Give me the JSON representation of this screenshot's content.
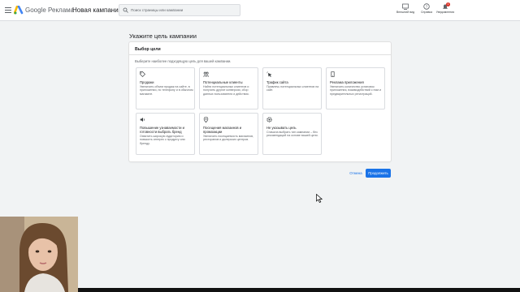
{
  "header": {
    "brand": "Google Реклама",
    "page_title": "Новая кампания",
    "search_placeholder": "Поиск страницы или кампании",
    "tools": [
      {
        "label": "Внешний вид",
        "icon": "appearance-icon"
      },
      {
        "label": "Справка",
        "icon": "help-icon"
      },
      {
        "label": "Уведомления",
        "icon": "notifications-icon",
        "badge": "1"
      }
    ]
  },
  "main": {
    "heading": "Укажите цель кампании",
    "panel": {
      "title": "Выбор цели",
      "subtitle": "Выберите наиболее подходящую цель для вашей кампании.",
      "cards": [
        {
          "icon": "tag-icon",
          "title": "Продажи",
          "description": "Увеличить объем продаж на сайте, в приложении, по телефону и в обычном магазине."
        },
        {
          "icon": "people-icon",
          "title": "Потенциальные клиенты",
          "description": "Найти потенциальных клиентов и получить другие конверсии, сбор данных пользователя и действия."
        },
        {
          "icon": "cursor-click-icon",
          "title": "Трафик сайта",
          "description": "Привлечь потенциальных клиентов на сайт."
        },
        {
          "icon": "phone-icon",
          "title": "Реклама приложения",
          "description": "Увеличить количество установок приложения, взаимодействий с ним и предварительных регистраций."
        },
        {
          "icon": "speaker-icon",
          "title": "Повышение узнаваемости и готовности выбрать бренд",
          "description": "Охватить широкую аудиторию и повысить интерес к продукту или бренду."
        },
        {
          "icon": "location-pin-icon",
          "title": "Посещения магазинов и промоакции",
          "description": "Увеличить посещаемость магазинов, ресторанов и дилерских центров."
        },
        {
          "icon": "settings-icon",
          "title": "Не указывать цель",
          "description": "Сначала выбрать тип кампании – без рекомендаций на основе вашей цели."
        }
      ]
    },
    "cancel_label": "Отмена",
    "continue_label": "Продолжить"
  },
  "colors": {
    "accent": "#1a73e8",
    "background": "#f1f3f4",
    "badge": "#d93025"
  }
}
